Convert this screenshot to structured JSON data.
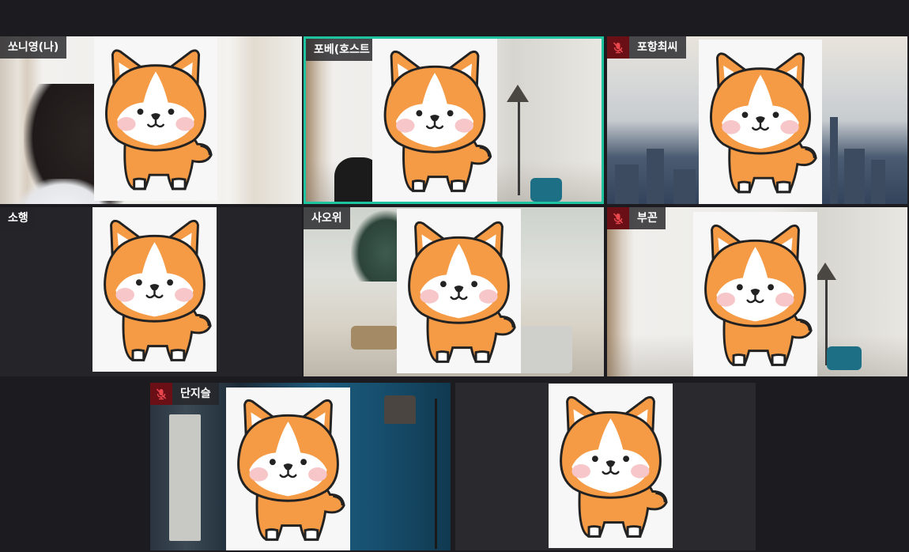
{
  "participants": [
    {
      "name": "쏘니영(나)",
      "muted": false,
      "active": false
    },
    {
      "name": "포베(호스트",
      "muted": false,
      "active": true
    },
    {
      "name": "포항최씨",
      "muted": true,
      "active": false
    },
    {
      "name": "소행",
      "muted": false,
      "active": false
    },
    {
      "name": "사오위",
      "muted": false,
      "active": false
    },
    {
      "name": "부꼰",
      "muted": true,
      "active": false
    },
    {
      "name": "단지슬",
      "muted": true,
      "active": false
    },
    {
      "name": "",
      "muted": false,
      "active": false
    }
  ],
  "icons": {
    "muted_mic": "mic-off-icon",
    "avatar": "corgi-avatar-icon"
  },
  "colors": {
    "active_border": "#1ec4a0",
    "muted_badge": "#6b0f16",
    "label_bg": "#242428",
    "corgi_orange": "#f59a45",
    "corgi_cheek": "#f7c6c8"
  }
}
